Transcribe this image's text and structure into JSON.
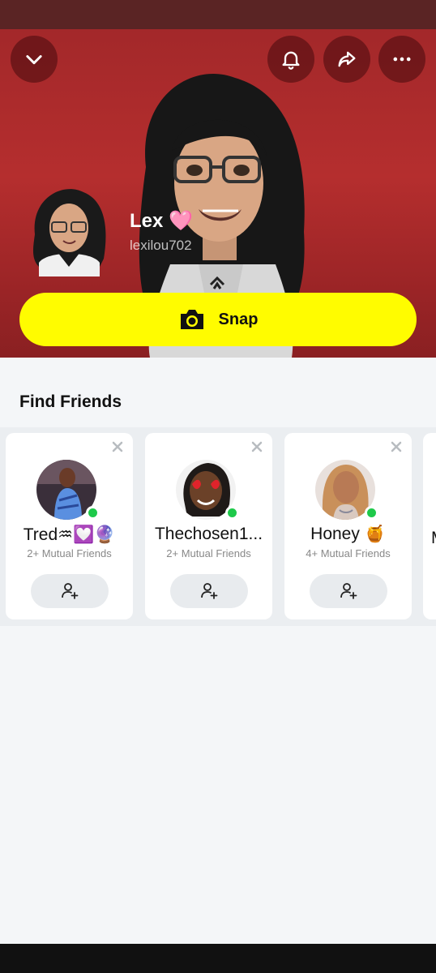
{
  "profile": {
    "name": "Lex 🩷",
    "username": "lexilou702"
  },
  "header_buttons": {
    "collapse": "chevron-down-icon",
    "notifications": "bell-icon",
    "share": "share-arrow-icon",
    "more": "more-dots-icon"
  },
  "snap_button": {
    "label": "Snap",
    "icon": "camera-icon"
  },
  "find_friends": {
    "title": "Find Friends",
    "cards": [
      {
        "name": "Tred♒💟🔮",
        "mutual": "2+ Mutual Friends",
        "online": true
      },
      {
        "name": "Thechosen1...",
        "mutual": "2+ Mutual Friends",
        "online": true
      },
      {
        "name": "Honey 🍯",
        "mutual": "4+ Mutual Friends",
        "online": true
      }
    ],
    "peek_letter": "M"
  },
  "colors": {
    "hero_red": "#b52e2e",
    "snap_yellow": "#fffc00",
    "online_green": "#1ec94a"
  }
}
